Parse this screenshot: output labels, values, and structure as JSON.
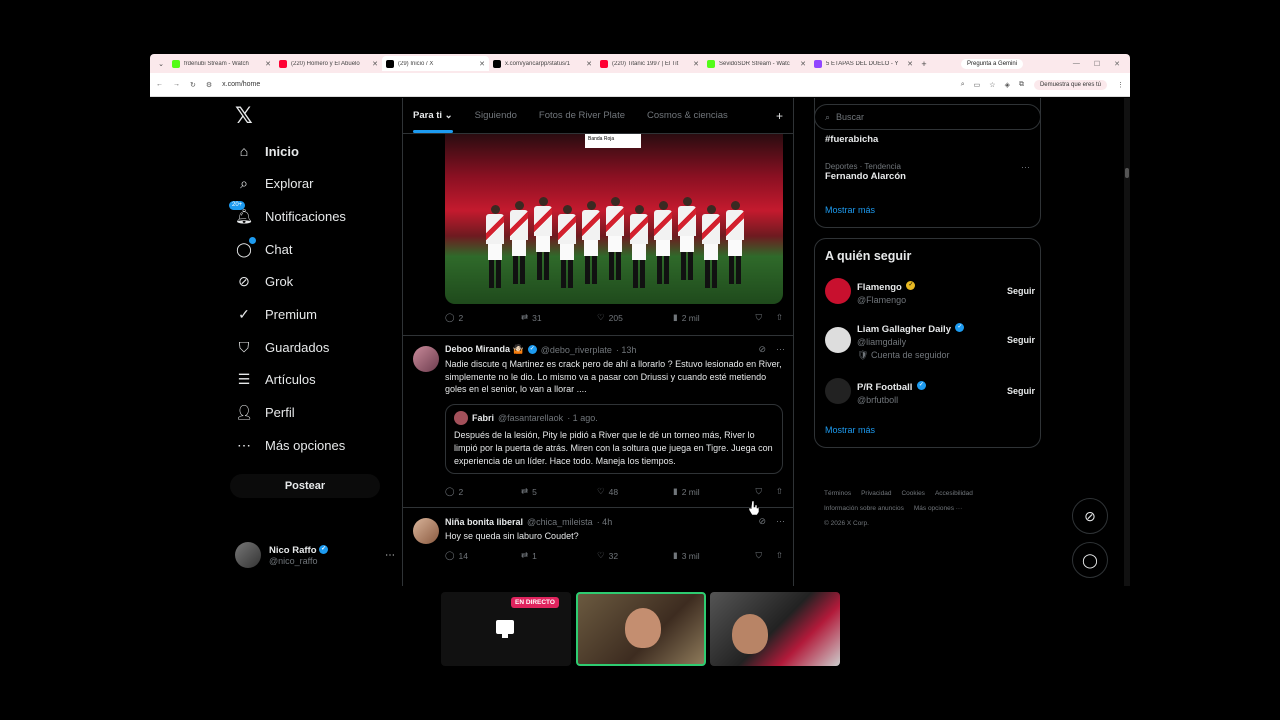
{
  "browser": {
    "tabs": [
      {
        "title": "frdenubi Stream - Watch",
        "color": "#53fc18"
      },
      {
        "title": "(220) Homero y El Abuelo",
        "color": "#ff0033"
      },
      {
        "title": "(29) Inicio / X",
        "color": "#000000",
        "active": true
      },
      {
        "title": "x.com/yancarpp/status/1",
        "color": "#000000"
      },
      {
        "title": "(220) Titanic 1997 | El Tit",
        "color": "#ff0033"
      },
      {
        "title": "SevidoSDR Stream - Watc",
        "color": "#53fc18"
      },
      {
        "title": "5 ETAPAS DEL DUELO - Y",
        "color": "#9146ff"
      }
    ],
    "gemini_label": "Pregunta a Gemini",
    "url": "x.com/home",
    "profile_label": "Demuestra que eres tú"
  },
  "nav": {
    "items": [
      {
        "label": "Inicio",
        "icon": "home-icon",
        "glyph": "⌂",
        "bold": true
      },
      {
        "label": "Explorar",
        "icon": "search-icon",
        "glyph": "⌕"
      },
      {
        "label": "Notificaciones",
        "icon": "bell-icon",
        "glyph": "🔔︎",
        "badge": "20+"
      },
      {
        "label": "Chat",
        "icon": "chat-icon",
        "glyph": "◯",
        "dot": true
      },
      {
        "label": "Grok",
        "icon": "grok-icon",
        "glyph": "⊘"
      },
      {
        "label": "Premium",
        "icon": "premium-icon",
        "glyph": "✓"
      },
      {
        "label": "Guardados",
        "icon": "bookmark-icon",
        "glyph": "⛉"
      },
      {
        "label": "Artículos",
        "icon": "article-icon",
        "glyph": "☰"
      },
      {
        "label": "Perfil",
        "icon": "profile-icon",
        "glyph": "👤︎"
      },
      {
        "label": "Más opciones",
        "icon": "more-icon",
        "glyph": "⋯"
      }
    ],
    "post_button": "Postear",
    "user": {
      "name": "Nico Raffo",
      "handle": "@nico_raffo"
    }
  },
  "timeline": {
    "tabs": [
      "Para ti",
      "Siguiendo",
      "Fotos de River Plate",
      "Cosmos & ciencias"
    ],
    "image_tag": "Banda Roja",
    "post1_actions": {
      "replies": "2",
      "reposts": "31",
      "likes": "205",
      "views": "2 mil"
    },
    "post2": {
      "name": "Deboo Miranda 🤷🏻",
      "handle": "@debo_riverplate",
      "time": "· 13h",
      "text": "Nadie discute q Martinez es crack pero de ahí a llorarlo ? Estuvo lesionado en River, simplemente no le dio. Lo mismo va a pasar con Driussi y cuando esté metiendo goles en el senior, lo van a llorar ....",
      "quote": {
        "name": "Fabri",
        "handle": "@fasantarellaok",
        "time": "· 1 ago.",
        "text": "Después de la lesión, Pity le pidió a River que le dé un torneo más, River lo limpió por la puerta de atrás. Miren con la soltura que juega en Tigre. Juega con experiencia de un líder. Hace todo. Maneja los tiempos."
      },
      "actions": {
        "replies": "2",
        "reposts": "5",
        "likes": "48",
        "views": "2 mil"
      }
    },
    "post3": {
      "name": "Niña bonita liberal",
      "handle": "@chica_mileista",
      "time": "· 4h",
      "text": "Hoy se queda sin laburo Coudet?",
      "actions": {
        "replies": "14",
        "reposts": "1",
        "likes": "32",
        "views": "3 mil"
      }
    }
  },
  "sidebar": {
    "search_placeholder": "Buscar",
    "trends": [
      {
        "category": "",
        "title": "#fuerabicha"
      },
      {
        "category": "Deportes · Tendencia",
        "title": "Fernando Alarcón"
      }
    ],
    "show_more": "Mostrar más",
    "follow": {
      "title": "A quién seguir",
      "items": [
        {
          "name": "Flamengo",
          "handle": "@Flamengo",
          "verified": "gold",
          "note": "",
          "color": "#c8102e"
        },
        {
          "name": "Liam Gallagher Daily",
          "handle": "@liamgdaily",
          "verified": "blue",
          "note": "Cuenta de seguidor",
          "color": "#dddddd"
        },
        {
          "name": "P/R Football",
          "handle": "@brfutboll",
          "verified": "blue",
          "note": "",
          "color": "#222222"
        }
      ],
      "button": "Seguir",
      "show_more": "Mostrar más"
    },
    "footer": [
      "Términos",
      "Privacidad",
      "Cookies",
      "Accesibilidad",
      "Información sobre anuncios",
      "Más opciones ···",
      "© 2026 X Corp."
    ]
  },
  "stream": {
    "live_label": "EN DIRECTO"
  }
}
